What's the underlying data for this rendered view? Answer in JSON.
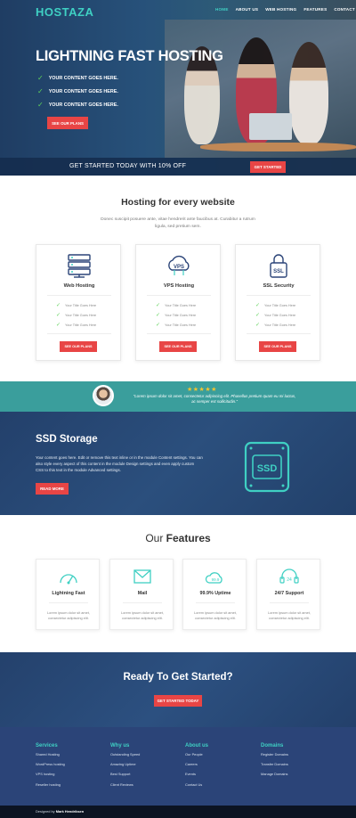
{
  "brand": "HOSTAZA",
  "nav": {
    "items": [
      {
        "label": "HOME",
        "active": true
      },
      {
        "label": "ABOUT US",
        "active": false
      },
      {
        "label": "WEB HOSTING",
        "active": false
      },
      {
        "label": "FEATURES",
        "active": false
      },
      {
        "label": "CONTACT",
        "active": false
      }
    ]
  },
  "hero": {
    "title_light": "LIGHTNING ",
    "title_bold": "FAST HOSTING",
    "bullets": [
      "YOUR CONTENT GOES HERE.",
      "YOUR CONTENT GOES HERE.",
      "YOUR CONTENT GOES HERE."
    ],
    "button": "SEE OUR PLANS",
    "strip_text": "GET STARTED TODAY WITH 10% OFF",
    "strip_button": "GET STARTED"
  },
  "hosting": {
    "title": "Hosting for every website",
    "description": "Donec suscipit posuere ante, vitae hendrerit ante faucibus at. Curabitur a rutrum ligula, sed pretium sem.",
    "cards": [
      {
        "icon": "server-icon",
        "title": "Web Hosting",
        "features": [
          "Your Title Goes Here",
          "Your Title Goes Here",
          "Your Title Goes Here"
        ],
        "button": "SEE OUR PLANS"
      },
      {
        "icon": "vps-cloud-icon",
        "title": "VPS Hosting",
        "features": [
          "Your Title Goes Here",
          "Your Title Goes Here",
          "Your Title Goes Here"
        ],
        "button": "SEE OUR PLANS"
      },
      {
        "icon": "ssl-lock-icon",
        "title": "SSL Security",
        "features": [
          "Your Title Goes Here",
          "Your Title Goes Here",
          "Your Title Goes Here"
        ],
        "button": "SEE OUR PLANS"
      }
    ]
  },
  "testimonial": {
    "stars": "★★★★★",
    "text": "\"Lorem ipsum dolor sit amet, consectetur adipiscing elit. Phasellus pretium quam eu mi luctus, ac semper est sollicitudin.\""
  },
  "ssd": {
    "title": "SSD Storage",
    "text": "Your content goes here. Edit or remove this text inline or in the module Content settings. You can also style every aspect of this content in the module Design settings and even apply custom CSS to this text in the module Advanced settings.",
    "button": "READ MORE",
    "icon_label": "SSD"
  },
  "features": {
    "title_light": "Our ",
    "title_bold": "Features",
    "cards": [
      {
        "icon": "speedometer-icon",
        "title": "Lightning Fast",
        "text": "Lorem ipsum dolor sit amet, consectetur adipiscing elit."
      },
      {
        "icon": "mail-icon",
        "title": "Mail",
        "text": "Lorem ipsum dolor sit amet, consectetur adipiscing elit."
      },
      {
        "icon": "uptime-cloud-icon",
        "title": "99.9% Uptime",
        "text": "Lorem ipsum dolor sit amet, consectetur adipiscing elit."
      },
      {
        "icon": "support-24-icon",
        "title": "24/7 Support",
        "text": "Lorem ipsum dolor sit amet, consectetur adipiscing elit."
      }
    ],
    "uptime_icon_label": "99.9",
    "support_icon_label": "24"
  },
  "cta": {
    "title": "Ready To Get Started?",
    "button": "GET STARTED TODAY"
  },
  "footer": {
    "columns": [
      {
        "title": "Services",
        "links": [
          "Shared Hosting",
          "WordPress hosting",
          "VPS hosting",
          "Reseller hosting"
        ]
      },
      {
        "title": "Why us",
        "links": [
          "Outstanding Speed",
          "Amazing Uptime",
          "Best Support",
          "Client Reviews"
        ]
      },
      {
        "title": "About us",
        "links": [
          "Our People",
          "Careers",
          "Events",
          "Contact Us"
        ]
      },
      {
        "title": "Domains",
        "links": [
          "Register Domains",
          "Transfer Domains",
          "Manage Domains"
        ]
      }
    ],
    "credit_prefix": "Designed by ",
    "credit_name": "Mark Hendriksen"
  },
  "colors": {
    "accent": "#3fd0c3",
    "button": "#e84545",
    "navy": "#2b4478",
    "teal": "#3a9e9c",
    "check": "#5fd35a"
  }
}
